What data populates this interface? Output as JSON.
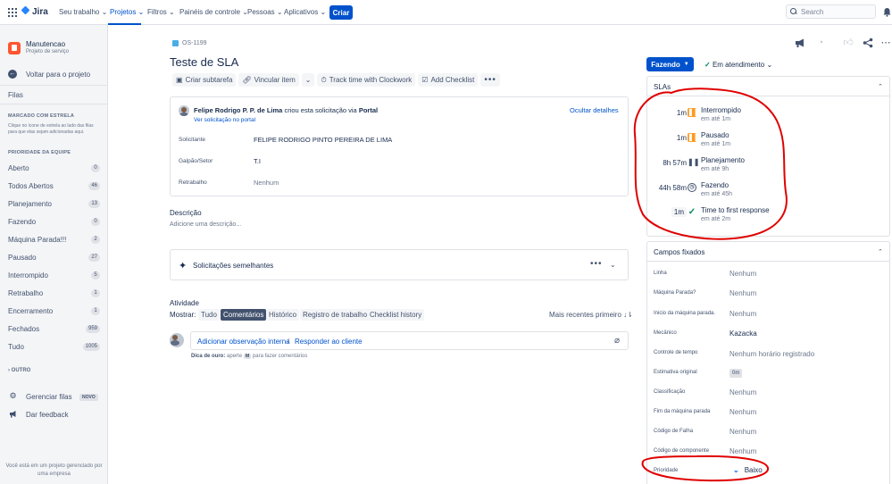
{
  "nav": {
    "logo": "Jira",
    "items": [
      "Seu trabalho",
      "Projetos",
      "Filtros",
      "Painéis de controle",
      "Pessoas",
      "Aplicativos"
    ],
    "create": "Criar",
    "search_placeholder": "Search"
  },
  "sidebar": {
    "project_name": "Manutencao",
    "project_type": "Projeto de serviço",
    "back": "Voltar para o projeto",
    "queues_title": "Filas",
    "starred_caption": "MARCADO COM ESTRELA",
    "starred_hint": "Clique no ícone de estrela ao lado das filas para que elas sejam adicionadas aqui.",
    "team_priority_caption": "PRIORIDADE DA EQUIPE",
    "queues": [
      {
        "label": "Aberto",
        "count": "0"
      },
      {
        "label": "Todos Abertos",
        "count": "46"
      },
      {
        "label": "Planejamento",
        "count": "13"
      },
      {
        "label": "Fazendo",
        "count": "0"
      },
      {
        "label": "Máquina Parada!!!",
        "count": "2"
      },
      {
        "label": "Pausado",
        "count": "27"
      },
      {
        "label": "Interrompido",
        "count": "5"
      },
      {
        "label": "Retrabalho",
        "count": "1"
      },
      {
        "label": "Encerramento",
        "count": "1"
      },
      {
        "label": "Fechados",
        "count": "959"
      },
      {
        "label": "Tudo",
        "count": "1005"
      }
    ],
    "other": "OUTRO",
    "manage_queues": "Gerenciar filas",
    "new_badge": "NOVO",
    "feedback": "Dar feedback",
    "footer": "Você está em um projeto gerenciado por uma empresa"
  },
  "issue": {
    "key": "OS-1199",
    "title": "Teste de SLA",
    "toolbar": {
      "subtask": "Criar subtarefa",
      "link": "Vincular item",
      "clockwork": "Track time with Clockwork",
      "checklist": "Add Checklist"
    },
    "request": {
      "author": "Felipe Rodrigo P. P. de Lima",
      "created_via": "criou esta solicitação via",
      "portal": "Portal",
      "portal_link": "Ver solicitação no portal",
      "hide": "Ocultar detalhes",
      "fields": [
        {
          "label": "Solicitante",
          "value": "FELIPE RODRIGO PINTO PEREIRA DE LIMA"
        },
        {
          "label": "Galpão/Setor",
          "value": "T.I"
        },
        {
          "label": "Retrabalho",
          "value": "Nenhum"
        }
      ]
    },
    "description_label": "Descrição",
    "description_placeholder": "Adicione uma descrição...",
    "similar": "Solicitações semelhantes",
    "activity": {
      "title": "Atividade",
      "show": "Mostrar:",
      "tabs": [
        "Tudo",
        "Comentários",
        "Histórico",
        "Registro de trabalho",
        "Checklist history"
      ],
      "active_tab": "Comentários",
      "sort": "Mais recentes primeiro",
      "internal": "Adicionar observação interna",
      "sep": "/",
      "reply": "Responder ao cliente",
      "tip_bold": "Dica de ouro:",
      "tip_pre": "aperte",
      "tip_key": "M",
      "tip_post": "para fazer comentários"
    }
  },
  "right": {
    "status": "Fazendo",
    "service_status": "Em atendimento",
    "sla_title": "SLAs",
    "slas": [
      {
        "time": "1m",
        "icon": "pause-icon",
        "name": "Interrompido",
        "sub": "em até 1m"
      },
      {
        "time": "1m",
        "icon": "pause-icon",
        "name": "Pausado",
        "sub": "em até 1m"
      },
      {
        "time": "8h 57m",
        "icon": "pause-icon",
        "name": "Planejamento",
        "sub": "em até 9h"
      },
      {
        "time": "44h 58m",
        "icon": "clock-icon",
        "name": "Fazendo",
        "sub": "em até 45h"
      },
      {
        "time": "1m",
        "icon": "check-icon",
        "name": "Time to first response",
        "sub": "em até 2m"
      }
    ],
    "fields_title": "Campos fixados",
    "fields": [
      {
        "label": "Linha",
        "value": "Nenhum"
      },
      {
        "label": "Máquina Parada?",
        "value": "Nenhum"
      },
      {
        "label": "Inicio da máquina parada.",
        "value": "Nenhum"
      },
      {
        "label": "Mecânico",
        "value": "Kazacka"
      },
      {
        "label": "Controle de tempo",
        "value": "Nenhum horário registrado"
      },
      {
        "label": "Estimativa original",
        "value": "0m"
      },
      {
        "label": "Classificação",
        "value": "Nenhum"
      },
      {
        "label": "Fim da máquina parada",
        "value": "Nenhum"
      },
      {
        "label": "Código de Falha",
        "value": "Nenhum"
      },
      {
        "label": "Código de componente",
        "value": "Nenhum"
      },
      {
        "label": "Prioridade",
        "value": "Baixo"
      }
    ]
  },
  "colors": {
    "brand": "#0052cc",
    "annotation": "#e00000",
    "paused": "#ff991f",
    "ok": "#00875a"
  }
}
